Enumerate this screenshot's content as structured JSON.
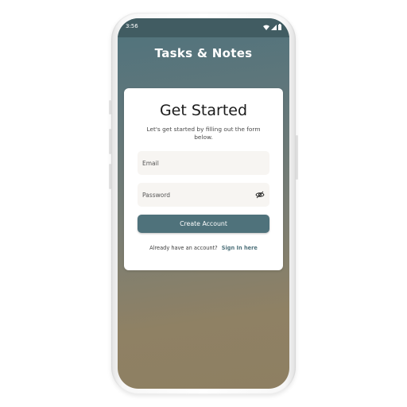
{
  "status_bar": {
    "time": "3:56",
    "icons": [
      "wifi-icon",
      "signal-icon",
      "battery-icon"
    ]
  },
  "app": {
    "title": "Tasks & Notes"
  },
  "card": {
    "title": "Get Started",
    "subtitle": "Let's get started by filling out the form below.",
    "email": {
      "placeholder": "Email",
      "value": ""
    },
    "password": {
      "placeholder": "Password",
      "value": "",
      "toggle_icon": "eye-off-icon"
    },
    "create_button": "Create Account",
    "signin_prompt": "Already have an account?",
    "signin_link": "Sign In here"
  },
  "colors": {
    "accent": "#4f727b",
    "status_bar": "#415c62",
    "card_bg": "#ffffff",
    "field_bg": "#f7f5f2"
  }
}
